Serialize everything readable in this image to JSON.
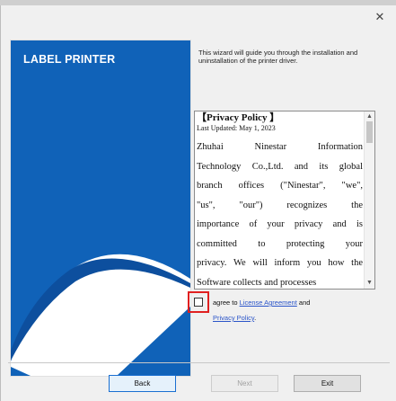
{
  "window": {
    "close_icon": "close-icon"
  },
  "hero": {
    "title": "LABEL PRINTER",
    "brand_color": "#1062b8",
    "accent_color": "#0d4f9e"
  },
  "intro": {
    "text": "This wizard will guide you through the installation and uninstallation of the printer driver."
  },
  "policy": {
    "title": "【Privacy Policy 】",
    "updated": "Last Updated: May 1, 2023",
    "lines": [
      "Zhuhai Ninestar Information",
      "Technology Co.,Ltd. and its global",
      "branch offices (\"Ninestar\", \"we\",",
      "\"us\", \"our\") recognizes the",
      "importance of your privacy and is",
      "committed to protecting your",
      "privacy. We will inform you how the",
      "Software collects and processes"
    ]
  },
  "agreement": {
    "prefix": "agree to ",
    "license_link": "License Agreement",
    "middle": " and",
    "privacy_link": "Privacy Policy",
    "suffix": ".",
    "checked": false,
    "highlight_color": "#e02020"
  },
  "buttons": {
    "back": "Back",
    "next": "Next",
    "exit": "Exit"
  }
}
